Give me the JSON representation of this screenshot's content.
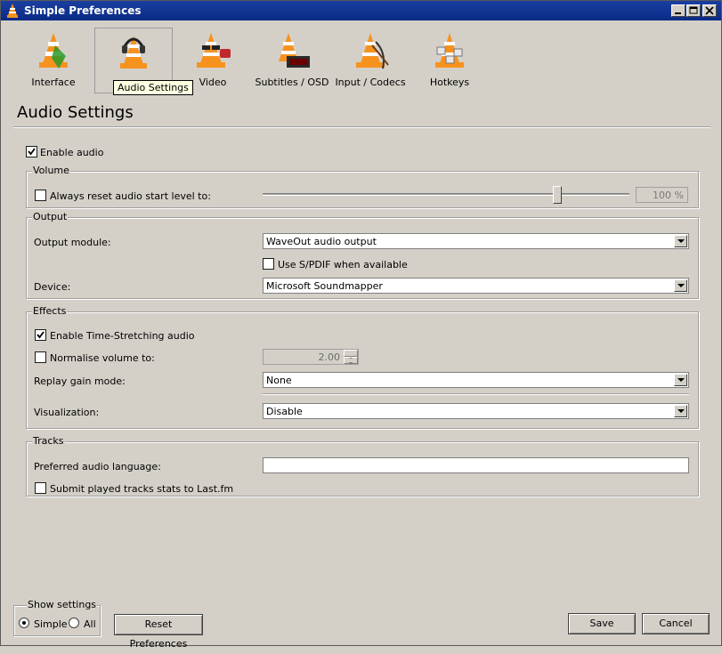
{
  "window": {
    "title": "Simple Preferences"
  },
  "tabs": [
    {
      "label": "Interface"
    },
    {
      "label": "Audio Settings"
    },
    {
      "label": "Video"
    },
    {
      "label": "Subtitles / OSD"
    },
    {
      "label": "Input / Codecs"
    },
    {
      "label": "Hotkeys"
    }
  ],
  "tooltip": "Audio Settings",
  "section_title": "Audio Settings",
  "enable_audio": {
    "label": "Enable audio",
    "checked": true
  },
  "volume": {
    "title": "Volume",
    "reset_label": "Always reset audio start level to:",
    "reset_checked": false,
    "level_text": "100 %",
    "level_percent": 100
  },
  "output": {
    "title": "Output",
    "module_label": "Output module:",
    "module_value": "WaveOut audio output",
    "spdif_label": "Use S/PDIF when available",
    "spdif_checked": false,
    "device_label": "Device:",
    "device_value": "Microsoft Soundmapper"
  },
  "effects": {
    "title": "Effects",
    "timestretch_label": "Enable Time-Stretching audio",
    "timestretch_checked": true,
    "normalise_label": "Normalise volume to:",
    "normalise_checked": false,
    "normalise_value": "2.00",
    "replaygain_label": "Replay gain mode:",
    "replaygain_value": "None",
    "visualization_label": "Visualization:",
    "visualization_value": "Disable"
  },
  "tracks": {
    "title": "Tracks",
    "language_label": "Preferred audio language:",
    "language_value": "",
    "lastfm_label": "Submit played tracks stats to Last.fm",
    "lastfm_checked": false
  },
  "footer": {
    "show_settings_title": "Show settings",
    "simple_label": "Simple",
    "all_label": "All",
    "simple_selected": true,
    "reset_label": "Reset Preferences",
    "save_label": "Save",
    "cancel_label": "Cancel"
  },
  "colors": {
    "titlebar": "#0a2a86",
    "cone_orange": "#f7921e",
    "tooltip_bg": "#ffffe1"
  }
}
